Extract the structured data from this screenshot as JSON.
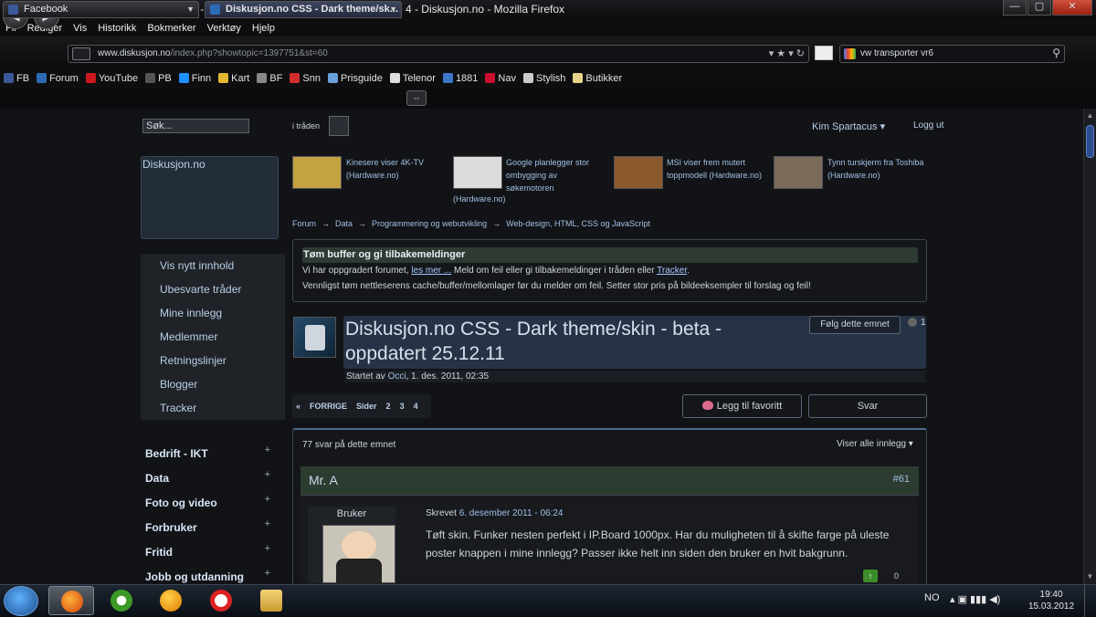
{
  "window": {
    "title": "Diskusjon.no CSS - Dark theme/skin - beta - oppdatert 25.12.11 - Forum - Side 4 - Diskusjon.no - Mozilla Firefox",
    "min": "—",
    "max": "▢",
    "close": "✕"
  },
  "menubar": [
    "Fil",
    "Rediger",
    "Vis",
    "Historikk",
    "Bokmerker",
    "Verktøy",
    "Hjelp"
  ],
  "nav": {
    "back": "◀",
    "forward": "▶",
    "url_host": "www.diskusjon.no",
    "url_path": "/index.php?showtopic=1397751&st=60",
    "url_tools": "▾   ★  ▾   ↻",
    "search_value": "vw transporter vr6",
    "search_icon": "⚲"
  },
  "bookmarks": [
    {
      "label": "FB",
      "color": "#3b5998"
    },
    {
      "label": "Forum",
      "color": "#2c6bb6"
    },
    {
      "label": "YouTube",
      "color": "#cc181e"
    },
    {
      "label": "PB",
      "color": "#555555"
    },
    {
      "label": "Finn",
      "color": "#1e90ff"
    },
    {
      "label": "Kart",
      "color": "#e3b830"
    },
    {
      "label": "BF",
      "color": "#888888"
    },
    {
      "label": "Snn",
      "color": "#d12d2d"
    },
    {
      "label": "Prisguide",
      "color": "#6aa0d8"
    },
    {
      "label": "Telenor",
      "color": "#dddddd"
    },
    {
      "label": "1881",
      "color": "#3d78c8"
    },
    {
      "label": "Nav",
      "color": "#c8102e"
    },
    {
      "label": "Stylish",
      "color": "#cccccc"
    },
    {
      "label": "Butikker",
      "color": "#e8d38a"
    }
  ],
  "tabs": [
    {
      "label": "Facebook",
      "color": "#3b5998"
    },
    {
      "label": "Diskusjon.no CSS - Dark theme/sk...",
      "color": "#2c6bb6"
    }
  ],
  "site": {
    "search_value": "Søk...",
    "scope_label": "i tråden",
    "user": "Kim Spartacus  ▾",
    "logout": "Logg ut",
    "brand": "Diskusjon.no"
  },
  "leftnav": [
    "Vis nytt innhold",
    "Ubesvarte tråder",
    "Mine innlegg",
    "Medlemmer",
    "Retningslinjer",
    "Blogger",
    "Tracker"
  ],
  "categories": [
    "Bedrift - IKT",
    "Data",
    "Foto og video",
    "Forbruker",
    "Fritid",
    "Jobb og utdanning"
  ],
  "news": [
    {
      "line1": "Kinesere viser 4K-TV",
      "line2": "(Hardware.no)",
      "line3": "",
      "line4": "",
      "color": "#c3a241"
    },
    {
      "line1": "Google planlegger stor",
      "line2": "ombygging av",
      "line3": "søkemotoren",
      "line4": "(Hardware.no)",
      "color": "#dcdcdc"
    },
    {
      "line1": "MSI viser frem mutert",
      "line2": "toppmodell (Hardware.no)",
      "line3": "",
      "line4": "",
      "color": "#8a5a2e"
    },
    {
      "line1": "Tynn turskjerm fra Toshiba",
      "line2": "(Hardware.no)",
      "line3": "",
      "line4": "",
      "color": "#7a6a5a"
    }
  ],
  "breadcrumb": [
    "Forum",
    "Data",
    "Programmering og webutvikling",
    "Web-design, HTML, CSS og JavaScript"
  ],
  "notice": {
    "title": "Tøm buffer og gi tilbakemeldinger",
    "line1_a": "Vi har oppgradert forumet, ",
    "line1_link1": "les mer ...",
    "line1_b": " Meld om feil eller gi tilbakemeldinger i tråden eller ",
    "line1_link2": "Tracker",
    "line1_c": ".",
    "line2": "Vennligst tøm nettleserens cache/buffer/mellomlager før du melder om feil. Setter stor pris på bildeeksempler til forslag og feil!"
  },
  "topic": {
    "title": "Diskusjon.no CSS - Dark theme/skin - beta - oppdatert 25.12.11",
    "follow": "Følg dette emnet",
    "followers": "1",
    "started_prefix": "Startet av ",
    "started_by": "Occi",
    "started_date": ", 1. des. 2011, 02:35"
  },
  "pager": {
    "prev_arrow": "«",
    "prev": "FORRIGE",
    "pages_label": "Sider",
    "pages": [
      "2",
      "3",
      "4"
    ]
  },
  "actions": {
    "favorite": "Legg til favoritt",
    "reply": "Svar"
  },
  "replies": {
    "count": "77 svar på dette emnet",
    "show_all": "Viser alle innlegg  ▾"
  },
  "post": {
    "author": "Mr. A",
    "number": "#61",
    "role": "Bruker",
    "posted_prefix": "Skrevet ",
    "posted_date": "6. desember 2011 - 06:24",
    "text": "Tøft skin. Funker nesten perfekt i IP.Board 1000px. Har du muligheten til å skifte farge på uleste poster knappen i mine innlegg? Passer ikke helt inn siden den bruker en hvit bakgrunn.",
    "vote_up": "↑",
    "votes": "0"
  },
  "taskbar": {
    "lang": "NO",
    "tray": "▴   ▣   ▮▮▮   ◀)",
    "time": "19:40",
    "date": "15.03.2012"
  }
}
